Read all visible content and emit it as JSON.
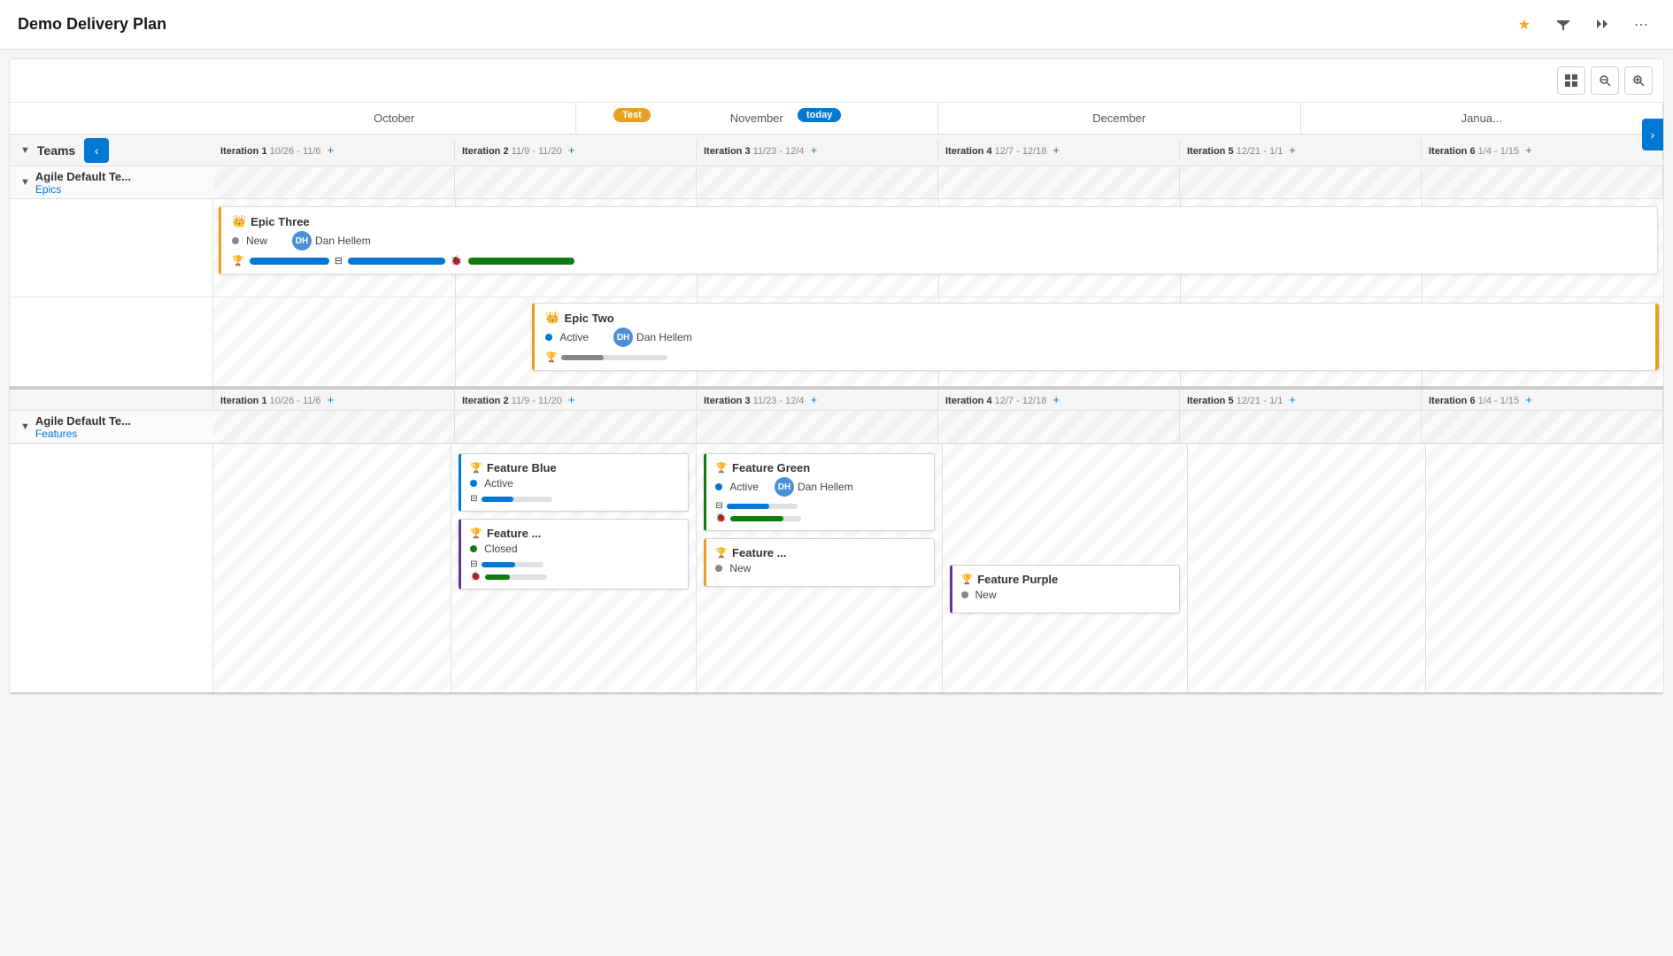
{
  "app": {
    "title": "Demo Delivery Plan"
  },
  "header": {
    "star_icon": "★",
    "filter_icon": "⧖",
    "collapse_icon": "⤢",
    "more_icon": "⋯"
  },
  "toolbar": {
    "grid_icon": "⊞",
    "zoom_out_icon": "−",
    "zoom_in_icon": "+"
  },
  "markers": {
    "test_label": "Test",
    "today_label": "today"
  },
  "months": [
    "October",
    "November",
    "December",
    "Janua..."
  ],
  "teams_header": {
    "label": "Teams",
    "nav_left": "‹",
    "nav_right": "›"
  },
  "team1": {
    "name": "Agile Default Te...",
    "sublabel": "Epics",
    "iterations": [
      {
        "name": "Iteration 1",
        "dates": "10/26 - 11/6"
      },
      {
        "name": "Iteration 2",
        "dates": "11/9 - 11/20"
      },
      {
        "name": "Iteration 3",
        "dates": "11/23 - 12/4"
      },
      {
        "name": "Iteration 4",
        "dates": "12/7 - 12/18"
      },
      {
        "name": "Iteration 5",
        "dates": "12/21 - 1/1"
      },
      {
        "name": "Iteration 6",
        "dates": "1/4 - 1/15"
      }
    ],
    "epic_three": {
      "title": "Epic Three",
      "status": "New",
      "assignee": "Dan Hellem",
      "assignee_initials": "DH"
    },
    "epic_two": {
      "title": "Epic Two",
      "status": "Active",
      "assignee": "Dan Hellem",
      "assignee_initials": "DH"
    }
  },
  "team2": {
    "name": "Agile Default Te...",
    "sublabel": "Features",
    "iterations": [
      {
        "name": "Iteration 1",
        "dates": "10/26 - 11/6"
      },
      {
        "name": "Iteration 2",
        "dates": "11/9 - 11/20"
      },
      {
        "name": "Iteration 3",
        "dates": "11/23 - 12/4"
      },
      {
        "name": "Iteration 4",
        "dates": "12/7 - 12/18"
      },
      {
        "name": "Iteration 5",
        "dates": "12/21 - 1/1"
      },
      {
        "name": "Iteration 6",
        "dates": "1/4 - 1/15"
      }
    ],
    "feature_blue": {
      "title": "Feature Blue",
      "status": "Active",
      "bar1_pct": 45,
      "bar2_pct": 0
    },
    "feature_green": {
      "title": "Feature Green",
      "status": "Active",
      "assignee": "Dan Hellem",
      "assignee_initials": "DH",
      "bar1_pct": 60,
      "bar2_pct": 75
    },
    "feature_blue2": {
      "title": "Feature ...",
      "status": "Closed",
      "bar1_pct": 55,
      "bar2_pct": 40
    },
    "feature_orange": {
      "title": "Feature ...",
      "status": "New"
    },
    "feature_purple": {
      "title": "Feature Purple",
      "status": "New"
    }
  },
  "colors": {
    "accent_blue": "#0078d4",
    "accent_orange": "#e8a020",
    "accent_green": "#107c10",
    "accent_purple": "#6b2fa0"
  }
}
